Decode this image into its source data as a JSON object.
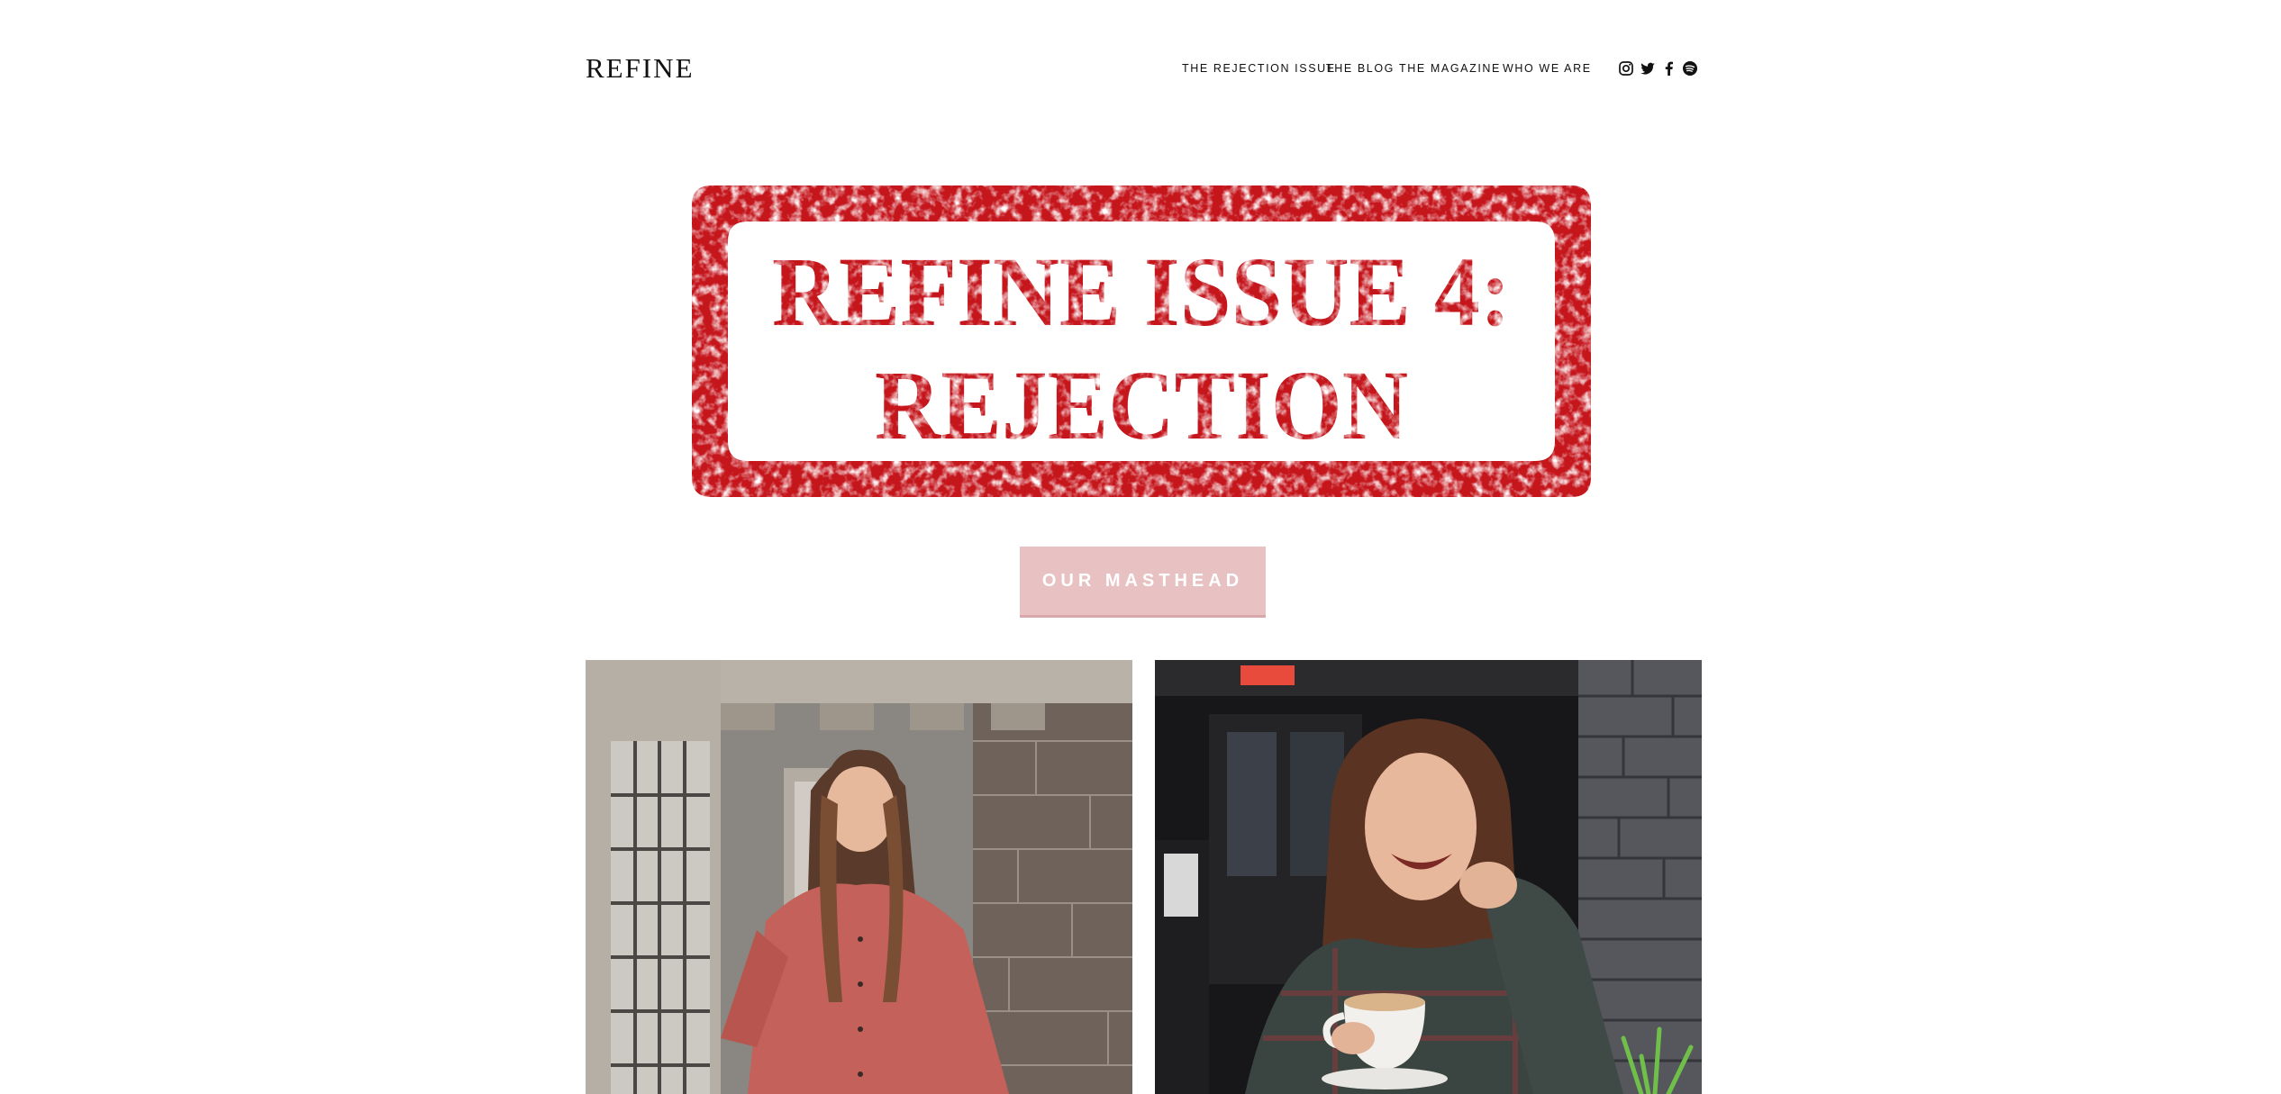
{
  "header": {
    "logo": "REFINE",
    "nav": [
      {
        "label": "THE REJECTION ISSUE"
      },
      {
        "label": "THE BLOG"
      },
      {
        "label": "THE MAGAZINE"
      },
      {
        "label": "WHO WE ARE"
      }
    ],
    "social": [
      "instagram-icon",
      "twitter-icon",
      "facebook-icon",
      "spotify-icon"
    ]
  },
  "banner": {
    "line1": "REFINE ISSUE 4:",
    "line2": "REJECTION",
    "color": "#c5161d"
  },
  "cta": {
    "label": "OUR MASTHEAD",
    "color": "#e8c1c3"
  },
  "photos": [
    {
      "description_icon": "portrait-photo"
    },
    {
      "description_icon": "portrait-photo"
    }
  ]
}
